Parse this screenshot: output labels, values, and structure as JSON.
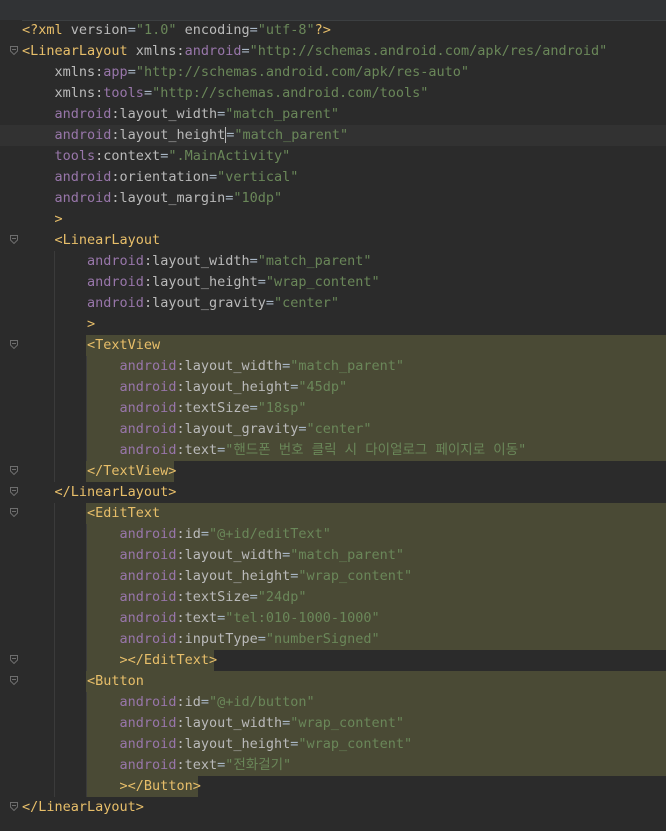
{
  "editor": {
    "lines": [
      {
        "segments": [
          {
            "t": "decl",
            "s": "<?xml "
          },
          {
            "t": "attr",
            "s": "version"
          },
          {
            "t": "plain",
            "s": "="
          },
          {
            "t": "val",
            "s": "\"1.0\""
          },
          {
            "t": "attr",
            "s": " encoding"
          },
          {
            "t": "plain",
            "s": "="
          },
          {
            "t": "val",
            "s": "\"utf-8\""
          },
          {
            "t": "decl",
            "s": "?>"
          }
        ]
      },
      {
        "segments": [
          {
            "t": "tag",
            "s": "<LinearLayout "
          },
          {
            "t": "attr",
            "s": "xmlns:"
          },
          {
            "t": "ns",
            "s": "android"
          },
          {
            "t": "plain",
            "s": "="
          },
          {
            "t": "val",
            "s": "\"http://schemas.android.com/apk/res/android\""
          }
        ]
      },
      {
        "segments": [
          {
            "t": "plain",
            "s": "    "
          },
          {
            "t": "attr",
            "s": "xmlns:"
          },
          {
            "t": "ns",
            "s": "app"
          },
          {
            "t": "plain",
            "s": "="
          },
          {
            "t": "val",
            "s": "\"http://schemas.android.com/apk/res-auto\""
          }
        ]
      },
      {
        "segments": [
          {
            "t": "plain",
            "s": "    "
          },
          {
            "t": "attr",
            "s": "xmlns:"
          },
          {
            "t": "ns",
            "s": "tools"
          },
          {
            "t": "plain",
            "s": "="
          },
          {
            "t": "val",
            "s": "\"http://schemas.android.com/tools\""
          }
        ]
      },
      {
        "segments": [
          {
            "t": "plain",
            "s": "    "
          },
          {
            "t": "ns",
            "s": "android"
          },
          {
            "t": "attr",
            "s": ":layout_width"
          },
          {
            "t": "plain",
            "s": "="
          },
          {
            "t": "val",
            "s": "\"match_parent\""
          }
        ]
      },
      {
        "segments": [
          {
            "t": "plain",
            "s": "    "
          },
          {
            "t": "ns",
            "s": "android"
          },
          {
            "t": "attr",
            "s": ":layout_height"
          },
          {
            "t": "plain",
            "s": "="
          },
          {
            "t": "val",
            "s": "\"match_parent\""
          }
        ]
      },
      {
        "segments": [
          {
            "t": "plain",
            "s": "    "
          },
          {
            "t": "ns",
            "s": "tools"
          },
          {
            "t": "attr",
            "s": ":context"
          },
          {
            "t": "plain",
            "s": "="
          },
          {
            "t": "val",
            "s": "\".MainActivity\""
          }
        ]
      },
      {
        "segments": [
          {
            "t": "plain",
            "s": "    "
          },
          {
            "t": "ns",
            "s": "android"
          },
          {
            "t": "attr",
            "s": ":orientation"
          },
          {
            "t": "plain",
            "s": "="
          },
          {
            "t": "val",
            "s": "\"vertical\""
          }
        ]
      },
      {
        "segments": [
          {
            "t": "plain",
            "s": "    "
          },
          {
            "t": "ns",
            "s": "android"
          },
          {
            "t": "attr",
            "s": ":layout_margin"
          },
          {
            "t": "plain",
            "s": "="
          },
          {
            "t": "val",
            "s": "\"10dp\""
          }
        ]
      },
      {
        "segments": [
          {
            "t": "plain",
            "s": "    "
          },
          {
            "t": "tag",
            "s": ">"
          }
        ]
      },
      {
        "segments": [
          {
            "t": "plain",
            "s": "    "
          },
          {
            "t": "tag",
            "s": "<LinearLayout"
          }
        ]
      },
      {
        "segments": [
          {
            "t": "plain",
            "s": "        "
          },
          {
            "t": "ns",
            "s": "android"
          },
          {
            "t": "attr",
            "s": ":layout_width"
          },
          {
            "t": "plain",
            "s": "="
          },
          {
            "t": "val",
            "s": "\"match_parent\""
          }
        ]
      },
      {
        "segments": [
          {
            "t": "plain",
            "s": "        "
          },
          {
            "t": "ns",
            "s": "android"
          },
          {
            "t": "attr",
            "s": ":layout_height"
          },
          {
            "t": "plain",
            "s": "="
          },
          {
            "t": "val",
            "s": "\"wrap_content\""
          }
        ]
      },
      {
        "segments": [
          {
            "t": "plain",
            "s": "        "
          },
          {
            "t": "ns",
            "s": "android"
          },
          {
            "t": "attr",
            "s": ":layout_gravity"
          },
          {
            "t": "plain",
            "s": "="
          },
          {
            "t": "val",
            "s": "\"center\""
          }
        ]
      },
      {
        "segments": [
          {
            "t": "plain",
            "s": "        "
          },
          {
            "t": "tag",
            "s": ">"
          }
        ]
      },
      {
        "segments": [
          {
            "t": "plain",
            "s": "        "
          },
          {
            "t": "tag",
            "s": "<TextView"
          }
        ]
      },
      {
        "segments": [
          {
            "t": "plain",
            "s": "            "
          },
          {
            "t": "ns",
            "s": "android"
          },
          {
            "t": "attr",
            "s": ":layout_width"
          },
          {
            "t": "plain",
            "s": "="
          },
          {
            "t": "val",
            "s": "\"match_parent\""
          }
        ]
      },
      {
        "segments": [
          {
            "t": "plain",
            "s": "            "
          },
          {
            "t": "ns",
            "s": "android"
          },
          {
            "t": "attr",
            "s": ":layout_height"
          },
          {
            "t": "plain",
            "s": "="
          },
          {
            "t": "val",
            "s": "\"45dp\""
          }
        ]
      },
      {
        "segments": [
          {
            "t": "plain",
            "s": "            "
          },
          {
            "t": "ns",
            "s": "android"
          },
          {
            "t": "attr",
            "s": ":textSize"
          },
          {
            "t": "plain",
            "s": "="
          },
          {
            "t": "val",
            "s": "\"18sp\""
          }
        ]
      },
      {
        "segments": [
          {
            "t": "plain",
            "s": "            "
          },
          {
            "t": "ns",
            "s": "android"
          },
          {
            "t": "attr",
            "s": ":layout_gravity"
          },
          {
            "t": "plain",
            "s": "="
          },
          {
            "t": "val",
            "s": "\"center\""
          }
        ]
      },
      {
        "segments": [
          {
            "t": "plain",
            "s": "            "
          },
          {
            "t": "ns",
            "s": "android"
          },
          {
            "t": "attr",
            "s": ":text"
          },
          {
            "t": "plain",
            "s": "="
          },
          {
            "t": "val",
            "s": "\"핸드폰 번호 클릭 시 다이얼로그 페이지로 이동\""
          }
        ]
      },
      {
        "segments": [
          {
            "t": "plain",
            "s": "        "
          },
          {
            "t": "tag",
            "s": "</TextView>"
          }
        ]
      },
      {
        "segments": [
          {
            "t": "plain",
            "s": "    "
          },
          {
            "t": "tag",
            "s": "</LinearLayout>"
          }
        ]
      },
      {
        "segments": [
          {
            "t": "plain",
            "s": "        "
          },
          {
            "t": "tag",
            "s": "<EditText"
          }
        ]
      },
      {
        "segments": [
          {
            "t": "plain",
            "s": "            "
          },
          {
            "t": "ns",
            "s": "android"
          },
          {
            "t": "attr",
            "s": ":id"
          },
          {
            "t": "plain",
            "s": "="
          },
          {
            "t": "val",
            "s": "\"@+id/editText\""
          }
        ]
      },
      {
        "segments": [
          {
            "t": "plain",
            "s": "            "
          },
          {
            "t": "ns",
            "s": "android"
          },
          {
            "t": "attr",
            "s": ":layout_width"
          },
          {
            "t": "plain",
            "s": "="
          },
          {
            "t": "val",
            "s": "\"match_parent\""
          }
        ]
      },
      {
        "segments": [
          {
            "t": "plain",
            "s": "            "
          },
          {
            "t": "ns",
            "s": "android"
          },
          {
            "t": "attr",
            "s": ":layout_height"
          },
          {
            "t": "plain",
            "s": "="
          },
          {
            "t": "val",
            "s": "\"wrap_content\""
          }
        ]
      },
      {
        "segments": [
          {
            "t": "plain",
            "s": "            "
          },
          {
            "t": "ns",
            "s": "android"
          },
          {
            "t": "attr",
            "s": ":textSize"
          },
          {
            "t": "plain",
            "s": "="
          },
          {
            "t": "val",
            "s": "\"24dp\""
          }
        ]
      },
      {
        "segments": [
          {
            "t": "plain",
            "s": "            "
          },
          {
            "t": "ns",
            "s": "android"
          },
          {
            "t": "attr",
            "s": ":text"
          },
          {
            "t": "plain",
            "s": "="
          },
          {
            "t": "val",
            "s": "\"tel:010-1000-1000\""
          }
        ]
      },
      {
        "segments": [
          {
            "t": "plain",
            "s": "            "
          },
          {
            "t": "ns",
            "s": "android"
          },
          {
            "t": "attr",
            "s": ":inputType"
          },
          {
            "t": "plain",
            "s": "="
          },
          {
            "t": "val",
            "s": "\"numberSigned\""
          }
        ]
      },
      {
        "segments": [
          {
            "t": "plain",
            "s": "            "
          },
          {
            "t": "tag",
            "s": "></EditText>"
          }
        ]
      },
      {
        "segments": [
          {
            "t": "plain",
            "s": "        "
          },
          {
            "t": "tag",
            "s": "<Button"
          }
        ]
      },
      {
        "segments": [
          {
            "t": "plain",
            "s": "            "
          },
          {
            "t": "ns",
            "s": "android"
          },
          {
            "t": "attr",
            "s": ":id"
          },
          {
            "t": "plain",
            "s": "="
          },
          {
            "t": "val",
            "s": "\"@+id/button\""
          }
        ]
      },
      {
        "segments": [
          {
            "t": "plain",
            "s": "            "
          },
          {
            "t": "ns",
            "s": "android"
          },
          {
            "t": "attr",
            "s": ":layout_width"
          },
          {
            "t": "plain",
            "s": "="
          },
          {
            "t": "val",
            "s": "\"wrap_content\""
          }
        ]
      },
      {
        "segments": [
          {
            "t": "plain",
            "s": "            "
          },
          {
            "t": "ns",
            "s": "android"
          },
          {
            "t": "attr",
            "s": ":layout_height"
          },
          {
            "t": "plain",
            "s": "="
          },
          {
            "t": "val",
            "s": "\"wrap_content\""
          }
        ]
      },
      {
        "segments": [
          {
            "t": "plain",
            "s": "            "
          },
          {
            "t": "ns",
            "s": "android"
          },
          {
            "t": "attr",
            "s": ":text"
          },
          {
            "t": "plain",
            "s": "="
          },
          {
            "t": "val",
            "s": "\"전화걸기\""
          }
        ]
      },
      {
        "segments": [
          {
            "t": "plain",
            "s": "            "
          },
          {
            "t": "tag",
            "s": "></Button>"
          }
        ]
      },
      {
        "segments": [
          {
            "t": "tag",
            "s": "</LinearLayout>"
          }
        ]
      }
    ]
  },
  "colors": {
    "background": "#2b2b2b",
    "tag": "#e8bf6a",
    "attribute": "#bababa",
    "namespace": "#9876aa",
    "value": "#6a8759",
    "highlight": "#4a4a35",
    "caret_line": "#323232"
  }
}
